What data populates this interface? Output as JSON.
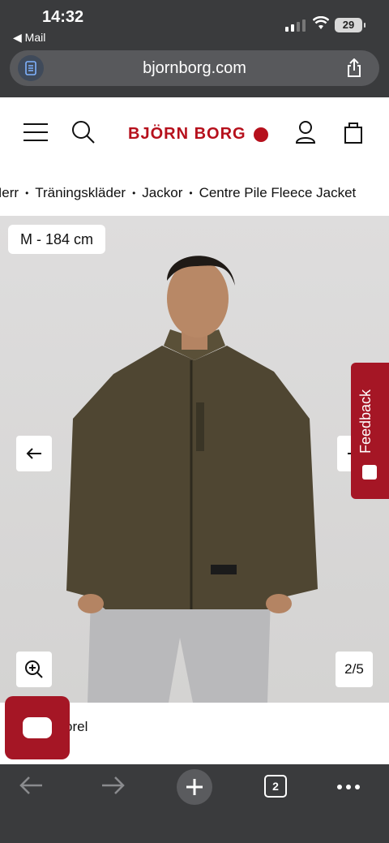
{
  "status": {
    "time": "14:32",
    "back_app": "◀ Mail",
    "battery": "29"
  },
  "browser": {
    "url": "bjornborg.com",
    "tabs_count": "2"
  },
  "header": {
    "logo": "BJÖRN BORG",
    "icons": [
      "menu-icon",
      "search-icon",
      "account-icon",
      "bag-icon"
    ]
  },
  "breadcrumb": [
    "Herr",
    "Träningskläder",
    "Jackor",
    "Centre Pile Fleece Jacket"
  ],
  "breadcrumb_separator": "•",
  "gallery": {
    "size_label": "M - 184 cm",
    "counter": "2/5",
    "feedback_label": "Feedback"
  },
  "info": {
    "partial_text": "orel"
  },
  "colors": {
    "brand": "#b6101c",
    "feedback": "#a51625",
    "chrome": "#3a3b3d"
  }
}
